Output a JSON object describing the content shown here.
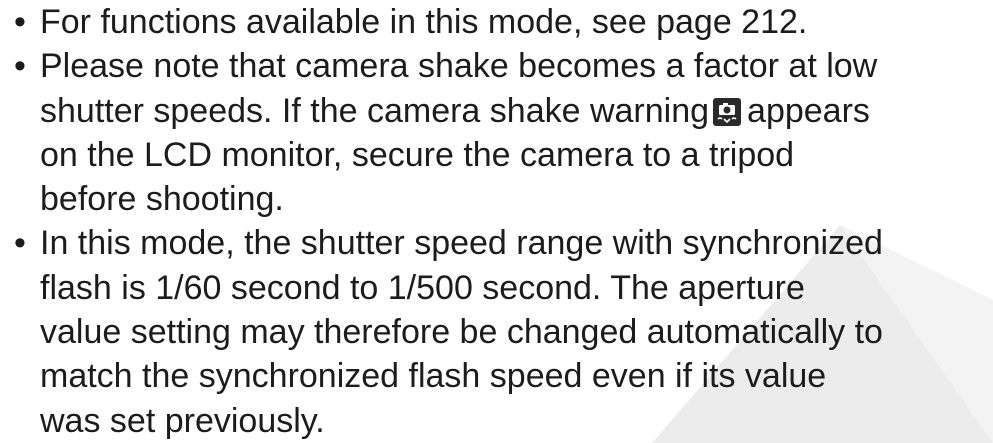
{
  "bullets": [
    {
      "lines": [
        "For functions available in this mode, see page 212."
      ]
    },
    {
      "lines": [
        "Please note that camera shake becomes a factor at low",
        "shutter speeds. If the camera shake warning",
        "appears",
        "on the LCD monitor, secure the camera to a tripod",
        "before shooting."
      ],
      "icon": "camera-shake-warning-icon"
    },
    {
      "lines": [
        "In this mode, the shutter speed range with synchronized",
        "flash is 1/60 second to 1/500 second. The aperture",
        "value setting may therefore be changed automatically to",
        "match the synchronized flash speed even if its value",
        "was set previously."
      ]
    }
  ],
  "colors": {
    "text": "#1c1c1c",
    "watermark": "#e8e8e8"
  }
}
